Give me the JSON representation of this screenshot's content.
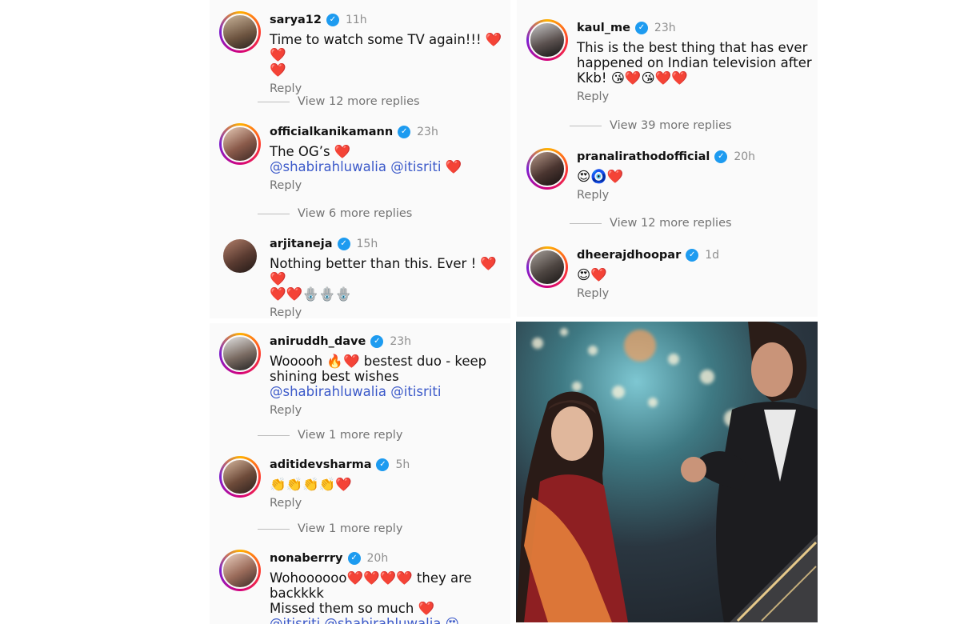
{
  "left_top": {
    "comments": [
      {
        "username": "sarya12",
        "time": "11h",
        "text_line1": "Time to watch some TV again!!! ❤️❤️",
        "text_line2": "❤️",
        "reply": "Reply",
        "view_more": "View 12 more replies"
      },
      {
        "username": "officialkanikamann",
        "time": "23h",
        "text_line1": "The OG’s ❤️",
        "mention1": "@shabirahluwalia",
        "mention2": "@itisriti",
        "text_after": " ❤️",
        "reply": "Reply",
        "view_more": "View 6 more replies"
      },
      {
        "username": "arjitaneja",
        "time": "15h",
        "text_line1": "Nothing better than this. Ever ! ❤️❤️",
        "text_line2": "❤️❤️🪬🪬🪬",
        "reply": "Reply"
      }
    ]
  },
  "left_bottom": {
    "comments": [
      {
        "username": "aniruddh_dave",
        "time": "23h",
        "text_line1": "Wooooh 🔥❤️ bestest duo - keep",
        "text_line2": "shining best wishes",
        "mention1": "@shabirahluwalia",
        "mention2": "@itisriti",
        "reply": "Reply",
        "view_more": "View 1 more reply"
      },
      {
        "username": "aditidevsharma",
        "time": "5h",
        "text_line1": "👏👏👏👏❤️",
        "reply": "Reply",
        "view_more": "View 1 more reply"
      },
      {
        "username": "nonaberrry",
        "time": "20h",
        "text_line1": "Wohoooooo❤️❤️❤️❤️ they are",
        "text_line2": "backkkk",
        "text_line3": "Missed them so much ❤️",
        "text_line4": "@itisriti @shabirahluwalia 😍"
      }
    ]
  },
  "right_top": {
    "comments": [
      {
        "username": "kaul_me",
        "time": "23h",
        "text_line1": "This is the best thing that has ever",
        "text_line2": "happened on Indian television after",
        "text_line3": "Kkb! 😘❤️😘❤️❤️",
        "reply": "Reply",
        "view_more": "View 39 more replies"
      },
      {
        "username": "pranalirathodofficial",
        "time": "20h",
        "text_line1": "😍🧿❤️",
        "reply": "Reply",
        "view_more": "View 12 more replies"
      },
      {
        "username": "dheerajdhoopar",
        "time": "1d",
        "text_line1": "😍❤️",
        "reply": "Reply"
      }
    ]
  },
  "verified_badge": "✓",
  "icons": {
    "verified": "verified-badge-icon"
  },
  "colors": {
    "verified": "#1d9bf0",
    "mention": "#3b59c9",
    "heart": "#ed2d4c",
    "muted": "#737373"
  }
}
